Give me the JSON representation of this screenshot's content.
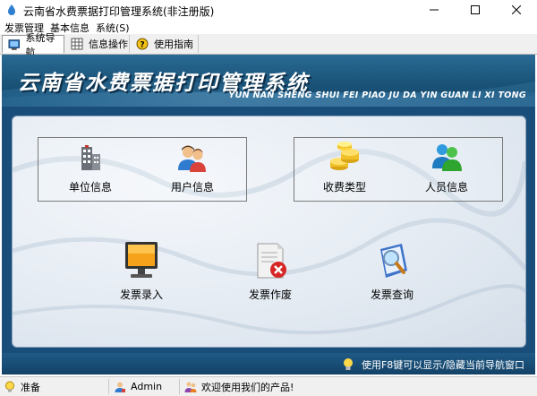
{
  "window": {
    "title": "云南省水费票据打印管理系统(非注册版)"
  },
  "menu": [
    "发票管理",
    "基本信息",
    "系统(S)"
  ],
  "tabs": [
    {
      "label": "系统导航",
      "icon": "monitor-icon",
      "active": true
    },
    {
      "label": "信息操作",
      "icon": "grid-icon",
      "active": false
    },
    {
      "label": "使用指南",
      "icon": "help-icon",
      "active": false
    }
  ],
  "banner": {
    "title": "云南省水费票据打印管理系统",
    "subtitle": "YUN NAN SHENG SHUI FEI PIAO JU DA YIN GUAN LI XI TONG"
  },
  "nav": {
    "group1": [
      {
        "label": "单位信息",
        "icon": "building-icon"
      },
      {
        "label": "用户信息",
        "icon": "users-icon"
      }
    ],
    "group2": [
      {
        "label": "收费类型",
        "icon": "coins-icon"
      },
      {
        "label": "人员信息",
        "icon": "people-icon"
      }
    ],
    "actions": [
      {
        "label": "发票录入",
        "icon": "monitor-screen-icon"
      },
      {
        "label": "发票作废",
        "icon": "void-document-icon"
      },
      {
        "label": "发票查询",
        "icon": "search-document-icon"
      }
    ]
  },
  "hint": "使用F8键可以显示/隐藏当前导航窗口",
  "status": {
    "state": "准备",
    "user": "Admin",
    "welcome": "欢迎使用我们的产品!"
  },
  "colors": {
    "banner": "#1a5378",
    "panel": "#e3eaf2",
    "accent": "#2a6a94"
  }
}
